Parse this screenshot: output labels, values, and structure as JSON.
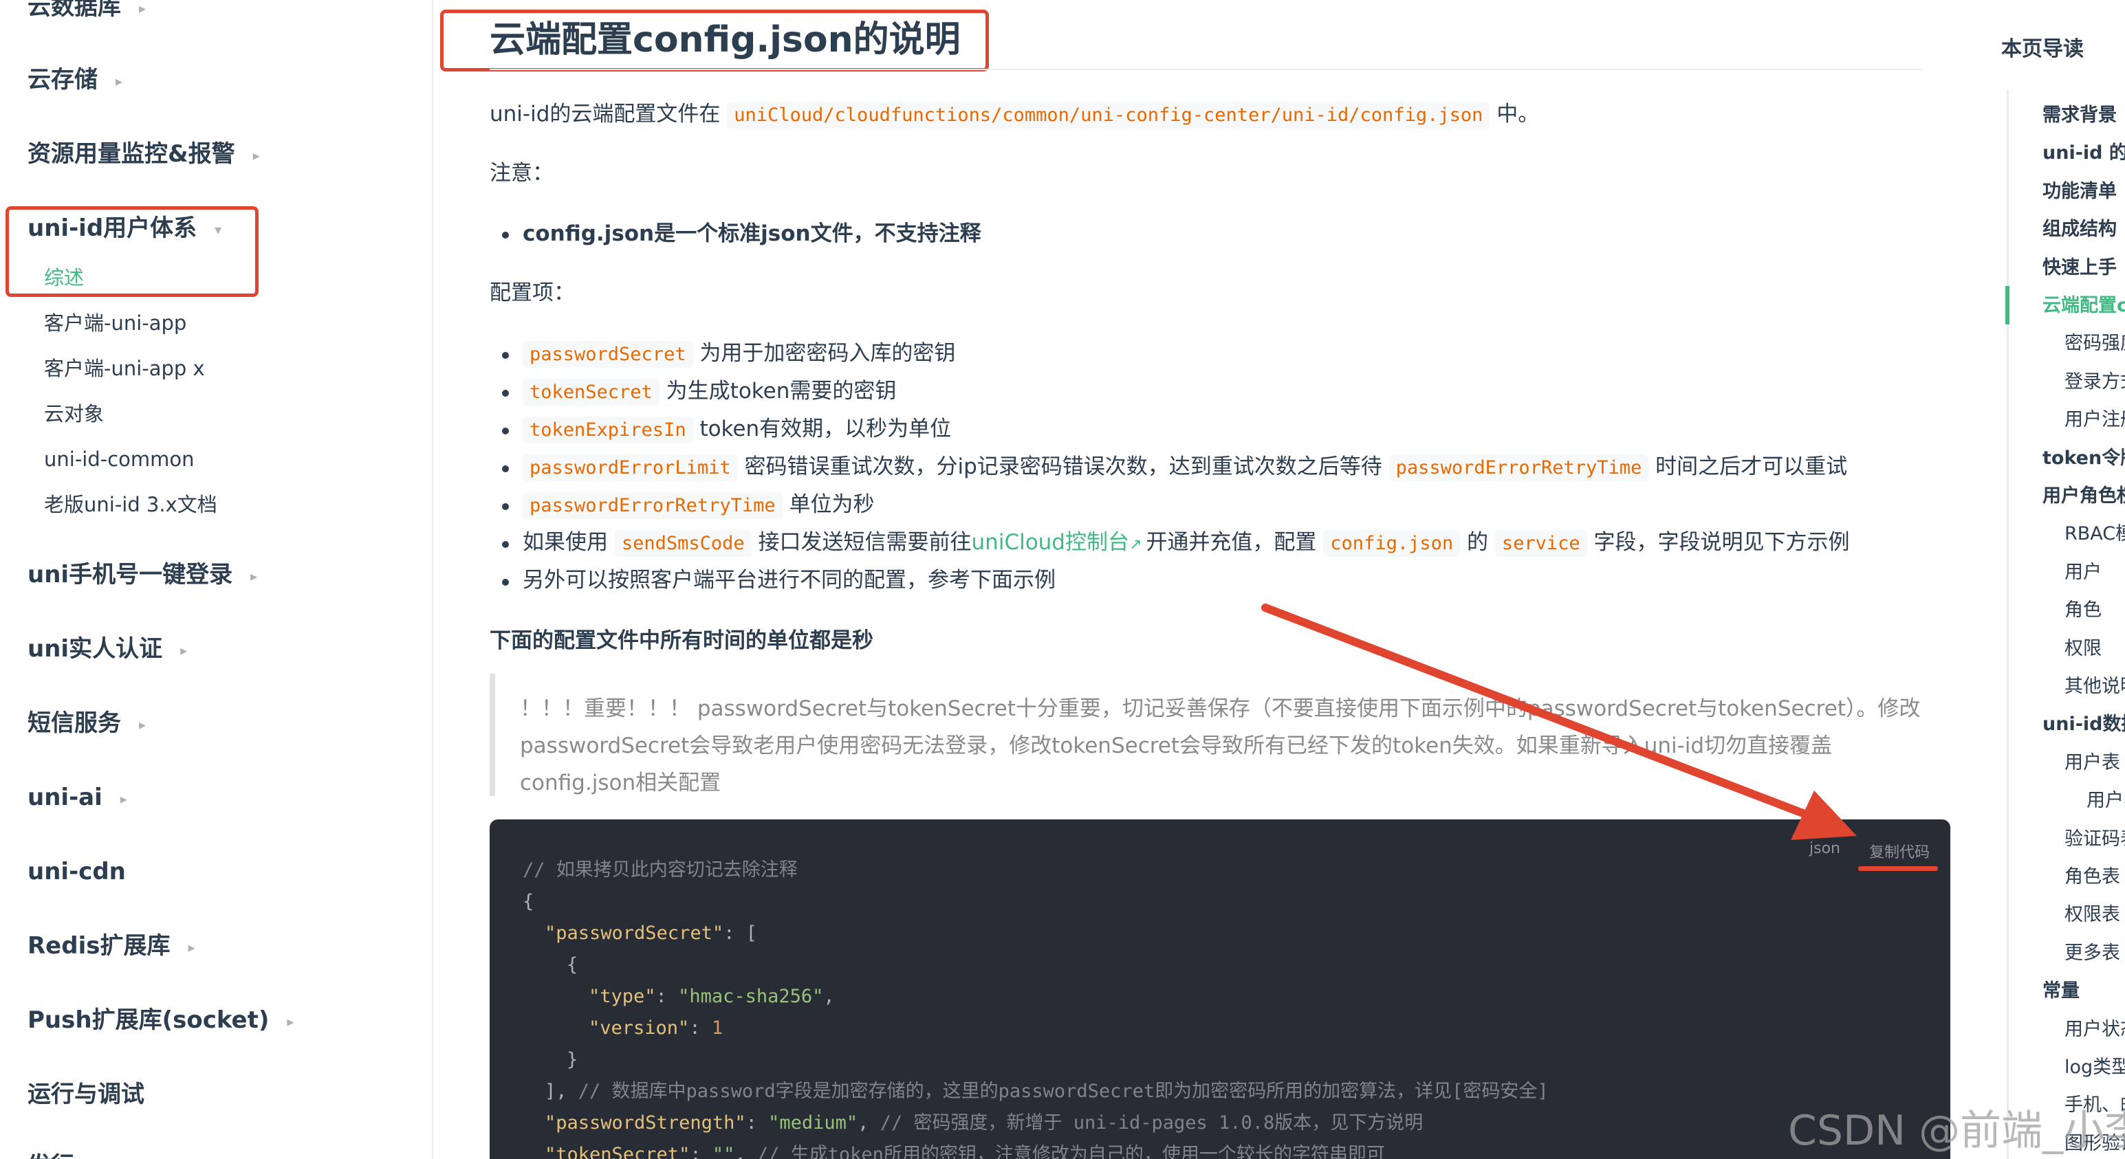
{
  "sidebar": {
    "groups": [
      {
        "label": "云数据库"
      },
      {
        "label": "云存储"
      },
      {
        "label": "资源用量监控&报警"
      },
      {
        "label": "uni-id用户体系"
      },
      {
        "label": "uni手机号一键登录"
      },
      {
        "label": "uni实人认证"
      },
      {
        "label": "短信服务"
      },
      {
        "label": "uni-ai"
      },
      {
        "label": "uni-cdn"
      },
      {
        "label": "Redis扩展库"
      },
      {
        "label": "Push扩展库(socket)"
      },
      {
        "label": "运行与调试"
      },
      {
        "label": "发行"
      }
    ],
    "uni_id_children": [
      {
        "label": "综述"
      },
      {
        "label": "客户端-uni-app"
      },
      {
        "label": "客户端-uni-app x"
      },
      {
        "label": "云对象"
      },
      {
        "label": "uni-id-common"
      },
      {
        "label": "老版uni-id 3.x文档"
      }
    ]
  },
  "main": {
    "title": "云端配置config.json的说明",
    "intro_prefix": "uni-id的云端配置文件在",
    "intro_path": "uniCloud/cloudfunctions/common/uni-config-center/uni-id/config.json",
    "intro_suffix": "中。",
    "note_label": "注意：",
    "note_item": "config.json是一个标准json文件，不支持注释",
    "config_label": "配置项：",
    "items": [
      {
        "code": "passwordSecret",
        "text": "为用于加密密码入库的密钥"
      },
      {
        "code": "tokenSecret",
        "text": "为生成token需要的密钥"
      },
      {
        "code": "tokenExpiresIn",
        "text": "token有效期，以秒为单位"
      },
      {
        "code": "passwordErrorLimit",
        "text": "密码错误重试次数，分ip记录密码错误次数，达到重试次数之后等待",
        "code2": "passwordErrorRetryTime",
        "text2": "时间之后才可以重试"
      },
      {
        "code": "passwordErrorRetryTime",
        "text": "单位为秒"
      }
    ],
    "sms_item": {
      "prefix": "如果使用",
      "code": "sendSmsCode",
      "middle": "接口发送短信需要前往",
      "link": "uniCloud控制台",
      "after_link": "开通并充值，配置",
      "code2": "config.json",
      "de": "的",
      "code3": "service",
      "suffix": "字段，字段说明见下方示例"
    },
    "platform_item": "另外可以按照客户端平台进行不同的配置，参考下面示例",
    "time_note": "下面的配置文件中所有时间的单位都是秒",
    "quote_lines": [
      "！！！重要！！！ passwordSecret与tokenSecret十分重要，切记妥善保存（不要直接使用下面示例中的passwordSecret与tokenSecret）。修改",
      "passwordSecret会导致老用户使用密码无法登录，修改tokenSecret会导致所有已经下发的token失效。如果重新导入uni-id切勿直接覆盖",
      "config.json相关配置"
    ],
    "code_block": {
      "lang": "json",
      "copy_label": "复制代码",
      "lines": {
        "l1": "// 如果拷贝此内容切记去除注释",
        "l2": "{",
        "l3_key": "\"passwordSecret\"",
        "l3_rest": ": [",
        "l4": "{",
        "l5_key": "\"type\"",
        "l5_val": "\"hmac-sha256\"",
        "l6_key": "\"version\"",
        "l6_val": "1",
        "l7": "}",
        "l8_code": "],",
        "l8_comment": "// 数据库中password字段是加密存储的，这里的passwordSecret即为加密密码所用的加密算法，详见[密码安全]",
        "l9_key": "\"passwordStrength\"",
        "l9_val": "\"medium\"",
        "l9_comment": "// 密码强度，新增于 uni-id-pages 1.0.8版本，见下方说明",
        "l10_key": "\"tokenSecret\"",
        "l10_val": "\"\"",
        "l10_comment": "// 生成token所用的密钥，注意修改为自己的，使用一个较长的字符串即可"
      }
    }
  },
  "toc": {
    "title": "本页导读",
    "items": [
      {
        "label": "需求背景",
        "level": 1
      },
      {
        "label": "uni-id 的价值",
        "level": 1
      },
      {
        "label": "功能清单",
        "level": 1
      },
      {
        "label": "组成结构",
        "level": 1
      },
      {
        "label": "快速上手",
        "level": 1
      },
      {
        "label": "云端配置con",
        "level": 1
      },
      {
        "label": "密码强度",
        "level": 2
      },
      {
        "label": "登录方式及",
        "level": 2
      },
      {
        "label": "用户注册时",
        "level": 2
      },
      {
        "label": "token令牌",
        "level": 1
      },
      {
        "label": "用户角色权限",
        "level": 1
      },
      {
        "label": "RBAC模型",
        "level": 2
      },
      {
        "label": "用户",
        "level": 2
      },
      {
        "label": "角色",
        "level": 2
      },
      {
        "label": "权限",
        "level": 2
      },
      {
        "label": "其他说明",
        "level": 2
      },
      {
        "label": "uni-id数据表",
        "level": 1
      },
      {
        "label": "用户表",
        "level": 2
      },
      {
        "label": "用户表索",
        "level": 3
      },
      {
        "label": "验证码表",
        "level": 2
      },
      {
        "label": "角色表",
        "level": 2
      },
      {
        "label": "权限表",
        "level": 2
      },
      {
        "label": "更多表",
        "level": 2
      },
      {
        "label": "常量",
        "level": 1
      },
      {
        "label": "用户状态",
        "level": 2
      },
      {
        "label": "log类型",
        "level": 2
      },
      {
        "label": "手机、邮箱",
        "level": 2
      },
      {
        "label": "图形验证码",
        "level": 2
      }
    ]
  },
  "watermark": "CSDN @前端_小李",
  "colors": {
    "accent": "#42b983",
    "annotation": "#e0452f",
    "code_bg": "#282c34",
    "inline_code": "#e96900"
  }
}
